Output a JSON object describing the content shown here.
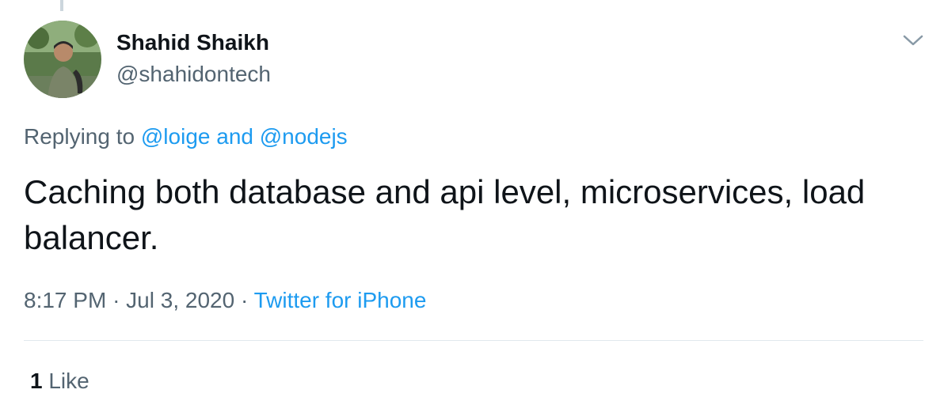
{
  "author": {
    "display_name": "Shahid Shaikh",
    "handle": "@shahidontech",
    "avatar": "user-avatar-photo"
  },
  "menu_icon": "chevron-down-icon",
  "reply_context": {
    "prefix": "Replying to",
    "mention_1": "@loige",
    "conjunction": "and",
    "mention_2": "@nodejs"
  },
  "tweet": {
    "text": "Caching both database and api level, microservices, load balancer."
  },
  "meta": {
    "time": "8:17 PM",
    "separator_1": "·",
    "date": "Jul 3, 2020",
    "separator_2": "·",
    "source": "Twitter for iPhone"
  },
  "stats": {
    "like_count": "1",
    "like_label": "Like"
  },
  "colors": {
    "accent": "#1d9bf0",
    "secondary_text": "#536471",
    "primary_text": "#0f1419"
  }
}
